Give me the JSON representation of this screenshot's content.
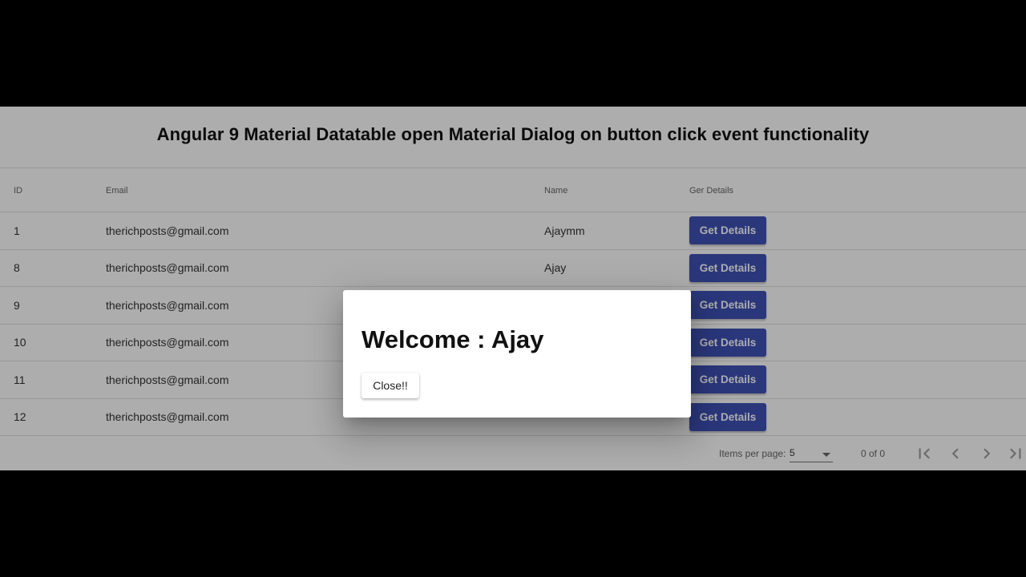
{
  "page": {
    "title": "Angular 9 Material Datatable open Material Dialog on button click event functionality"
  },
  "table": {
    "headers": [
      "ID",
      "Email",
      "Name",
      "Ger Details"
    ],
    "button_label": "Get Details",
    "rows": [
      {
        "id": "1",
        "email": "therichposts@gmail.com",
        "name": "Ajaymm"
      },
      {
        "id": "8",
        "email": "therichposts@gmail.com",
        "name": "Ajay"
      },
      {
        "id": "9",
        "email": "therichposts@gmail.com",
        "name": ""
      },
      {
        "id": "10",
        "email": "therichposts@gmail.com",
        "name": ""
      },
      {
        "id": "11",
        "email": "therichposts@gmail.com",
        "name": ""
      },
      {
        "id": "12",
        "email": "therichposts@gmail.com",
        "name": ""
      }
    ]
  },
  "paginator": {
    "items_per_page_label": "Items per page:",
    "page_size": "5",
    "range_label": "0 of 0",
    "icons": [
      "first-page-icon",
      "chevron-left-icon",
      "chevron-right-icon",
      "last-page-icon"
    ]
  },
  "dialog": {
    "title": "Welcome : Ajay",
    "close_label": "Close!!"
  },
  "colors": {
    "primary": "#3f51b5",
    "backdrop": "rgba(0,0,0,0.32)"
  }
}
